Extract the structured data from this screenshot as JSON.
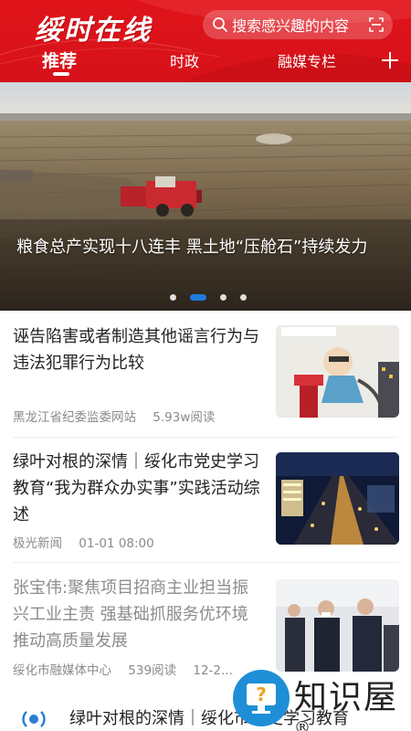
{
  "header": {
    "logo": "绥时在线",
    "search_placeholder": "搜索感兴趣的内容",
    "brand_color": "#e0141a"
  },
  "tabs": [
    {
      "label": "推荐",
      "active": true
    },
    {
      "label": "时政",
      "active": false
    },
    {
      "label": "融媒专栏",
      "active": false
    }
  ],
  "banner": {
    "caption": "粮食总产实现十八连丰 黑土地“压舱石”持续发力",
    "slides": 4,
    "active_slide": 2,
    "indicator_color": "#1e7bdc"
  },
  "news": [
    {
      "title": "诬告陷害或者制造其他谣言行为与违法犯罪行为比较",
      "source": "黑龙江省纪委监委网站",
      "reads": "5.93w阅读",
      "date": "",
      "thumb": "cartoon-illustration"
    },
    {
      "title": "绿叶对根的深情｜绥化市党史学习教育“我为群众办实事”实践活动综述",
      "source": "极光新闻",
      "reads": "",
      "date": "01-01 08:00",
      "thumb": "night-city-aerial"
    },
    {
      "title": "张宝伟:聚焦项目招商主业担当振兴工业主责 强基础抓服务优环境推动高质量发展",
      "source": "绥化市融媒体中心",
      "reads": "539阅读",
      "date": "12-2...",
      "thumb": "officials-visit-photo"
    }
  ],
  "bottom_item": {
    "title": "绿叶对根的深情｜绥化市党史学习教育"
  },
  "watermark": {
    "text": "知识屋",
    "mark": "®"
  }
}
